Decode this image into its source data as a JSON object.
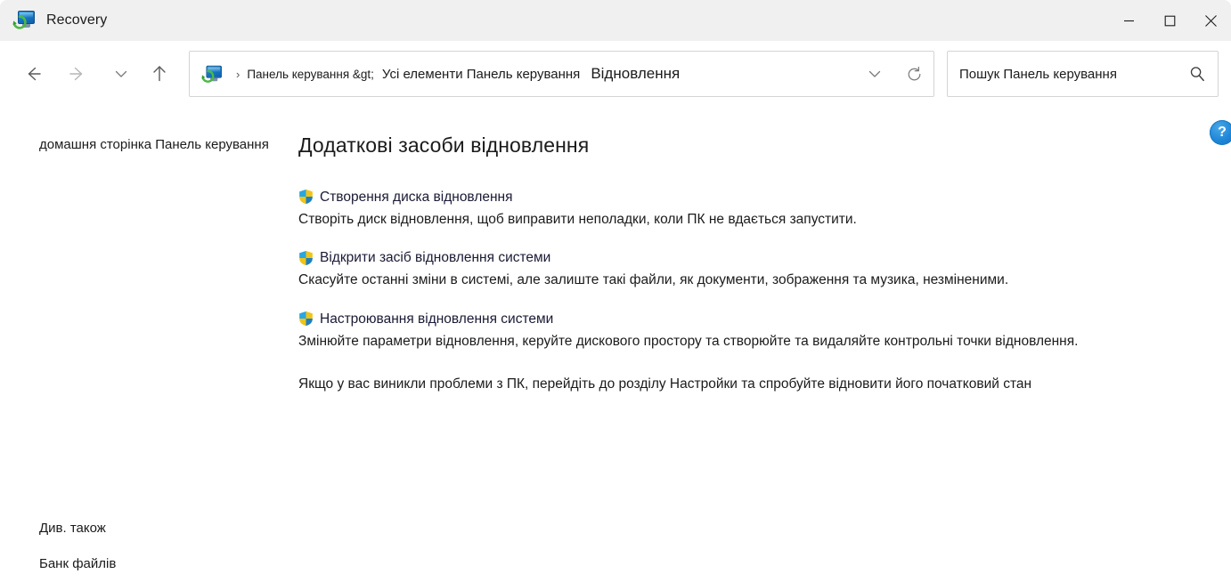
{
  "window": {
    "title": "Recovery",
    "icon": "recovery-monitor-icon",
    "controls": {
      "minimize": "—",
      "maximize": "□",
      "close": "✕"
    }
  },
  "nav": {
    "back": "back-arrow",
    "forward": "forward-arrow",
    "recent": "chevron-down",
    "up": "up-arrow",
    "refresh": "refresh-icon",
    "dropdown": "chevron-down"
  },
  "address": {
    "icon": "recovery-monitor-icon",
    "separator": "›",
    "crumbs": [
      "Панель керування &gt;",
      "Усі елементи Панель керування",
      "Відновлення"
    ]
  },
  "search": {
    "placeholder": "Пошук Панель керування",
    "value": "",
    "icon": "search-icon"
  },
  "sidebar": {
    "home_link": "домашня сторінка Панель керування",
    "see_also_title": "Див. також",
    "see_also_items": [
      "Банк файлів"
    ]
  },
  "main": {
    "page_title": "Додаткові засоби відновлення",
    "tasks": [
      {
        "icon": "uac-shield-icon",
        "link": "Створення диска відновлення",
        "desc": "Створіть диск відновлення, щоб виправити неполадки, коли ПК не вдається запустити."
      },
      {
        "icon": "uac-shield-icon",
        "link": "Відкрити засіб відновлення системи",
        "desc": "Скасуйте останні зміни в системі, але залиште такі файли, як документи, зображення та музика, незміненими."
      },
      {
        "icon": "uac-shield-icon",
        "link": "Настроювання відновлення системи",
        "desc": "Змінюйте параметри відновлення, керуйте дискового простору та створюйте та видаляйте контрольні точки відновлення."
      }
    ],
    "closing_note": "Якщо у вас виникли проблеми з ПК, перейдіть до розділу Настройки та спробуйте відновити його початковий стан"
  },
  "help": {
    "label": "?",
    "icon": "help-icon"
  },
  "colors": {
    "titlebar_bg": "#f0f0f0",
    "body_bg": "#ffffff",
    "text": "#1b1b1b",
    "link": "#1a1a35",
    "border": "#d4d4d4",
    "help_blue": "#1e87d8",
    "shield_blue": "#1e90d8",
    "shield_gold": "#f0c419"
  }
}
